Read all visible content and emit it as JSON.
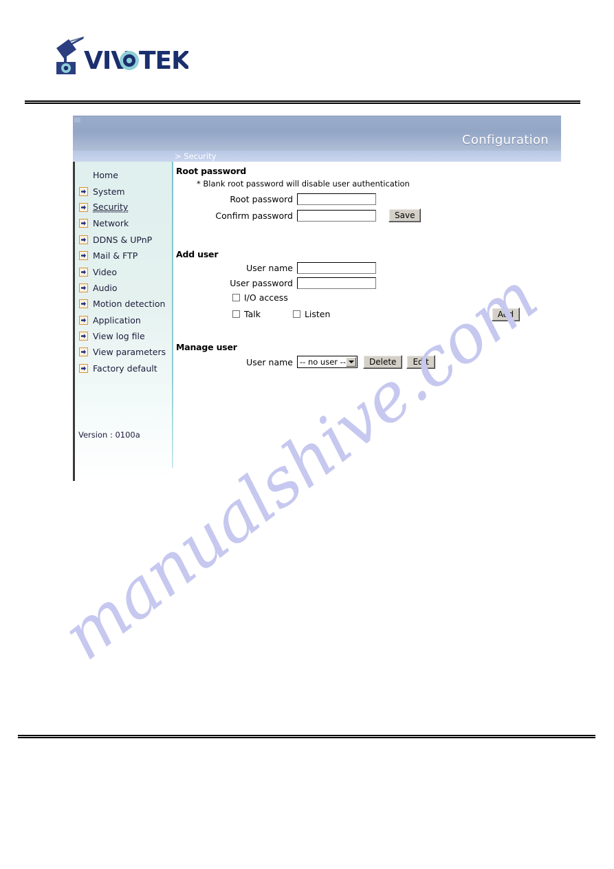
{
  "brand": {
    "name": "VIVOTEK",
    "logo_icon": "camera-logo-icon"
  },
  "header": {
    "title": "Configuration"
  },
  "breadcrumb": {
    "text": "> Security"
  },
  "sidebar": {
    "items": [
      {
        "label": "Home",
        "icon": "none",
        "active": false
      },
      {
        "label": "System",
        "icon": "arrow-icon",
        "active": false
      },
      {
        "label": "Security",
        "icon": "arrow-icon",
        "active": true
      },
      {
        "label": "Network",
        "icon": "arrow-icon",
        "active": false
      },
      {
        "label": "DDNS & UPnP",
        "icon": "arrow-icon",
        "active": false
      },
      {
        "label": "Mail & FTP",
        "icon": "arrow-icon",
        "active": false
      },
      {
        "label": "Video",
        "icon": "arrow-icon",
        "active": false
      },
      {
        "label": "Audio",
        "icon": "arrow-icon",
        "active": false
      },
      {
        "label": "Motion detection",
        "icon": "arrow-icon",
        "active": false
      },
      {
        "label": "Application",
        "icon": "arrow-icon",
        "active": false
      },
      {
        "label": "View log file",
        "icon": "arrow-icon",
        "active": false
      },
      {
        "label": "View parameters",
        "icon": "arrow-icon",
        "active": false
      },
      {
        "label": "Factory default",
        "icon": "arrow-icon",
        "active": false
      }
    ],
    "version": "Version : 0100a"
  },
  "root_password": {
    "heading": "Root password",
    "note": "* Blank root password will disable user authentication",
    "root_label": "Root password",
    "root_value": "",
    "confirm_label": "Confirm password",
    "confirm_value": "",
    "save_label": "Save"
  },
  "add_user": {
    "heading": "Add user",
    "username_label": "User name",
    "username_value": "",
    "password_label": "User password",
    "password_value": "",
    "io_access_label": "I/O access",
    "io_access_checked": false,
    "talk_label": "Talk",
    "talk_checked": false,
    "listen_label": "Listen",
    "listen_checked": false,
    "add_label": "Add"
  },
  "manage_user": {
    "heading": "Manage user",
    "username_label": "User name",
    "selected_user": "-- no user --",
    "options": [
      "-- no user --"
    ],
    "delete_label": "Delete",
    "edit_label": "Edit"
  },
  "watermark": {
    "text": "manualshive.com"
  },
  "colors": {
    "header_blue": "#93a6c6",
    "crumb_blue": "#c2d0ea",
    "sidebar_mint": "#dff0ee",
    "divider_cyan": "#7fc3cf",
    "icon_orange": "#d8913c",
    "logo_navy": "#1b2f6e",
    "watermark_purple": "#c6c8ef"
  }
}
